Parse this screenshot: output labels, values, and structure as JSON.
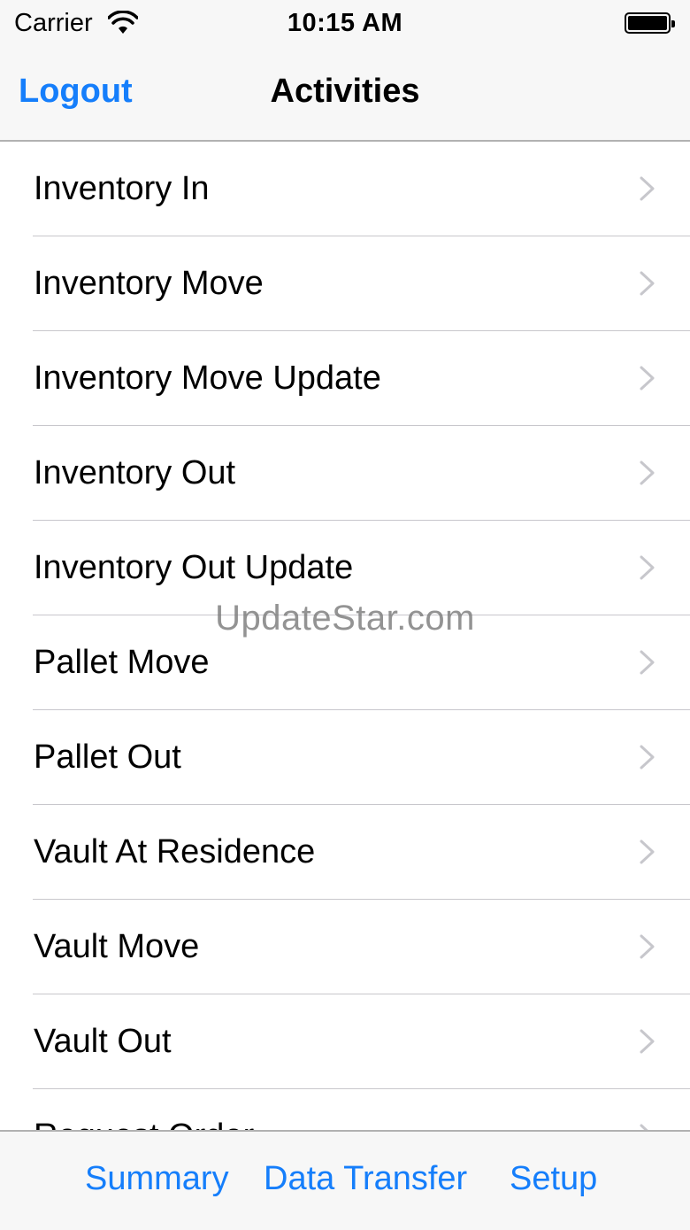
{
  "status_bar": {
    "carrier": "Carrier",
    "time": "10:15 AM",
    "wifi_icon": "wifi-icon",
    "battery_icon": "battery-icon"
  },
  "nav_bar": {
    "left_button": "Logout",
    "title": "Activities"
  },
  "activities": [
    {
      "label": "Inventory In"
    },
    {
      "label": "Inventory Move"
    },
    {
      "label": "Inventory Move Update"
    },
    {
      "label": "Inventory Out"
    },
    {
      "label": "Inventory Out Update"
    },
    {
      "label": "Pallet Move"
    },
    {
      "label": "Pallet Out"
    },
    {
      "label": "Vault At Residence"
    },
    {
      "label": "Vault Move"
    },
    {
      "label": "Vault Out"
    },
    {
      "label": "Request Order"
    }
  ],
  "row_icon": "chevron-right-icon",
  "watermark": "UpdateStar.com",
  "tab_bar": {
    "tabs": [
      {
        "label": "Summary"
      },
      {
        "label": "Data Transfer"
      },
      {
        "label": "Setup"
      }
    ]
  },
  "colors": {
    "accent": "#157efb",
    "bar_background": "#f7f7f7",
    "separator": "#c8c7cc",
    "chevron": "#c7c7cc"
  }
}
